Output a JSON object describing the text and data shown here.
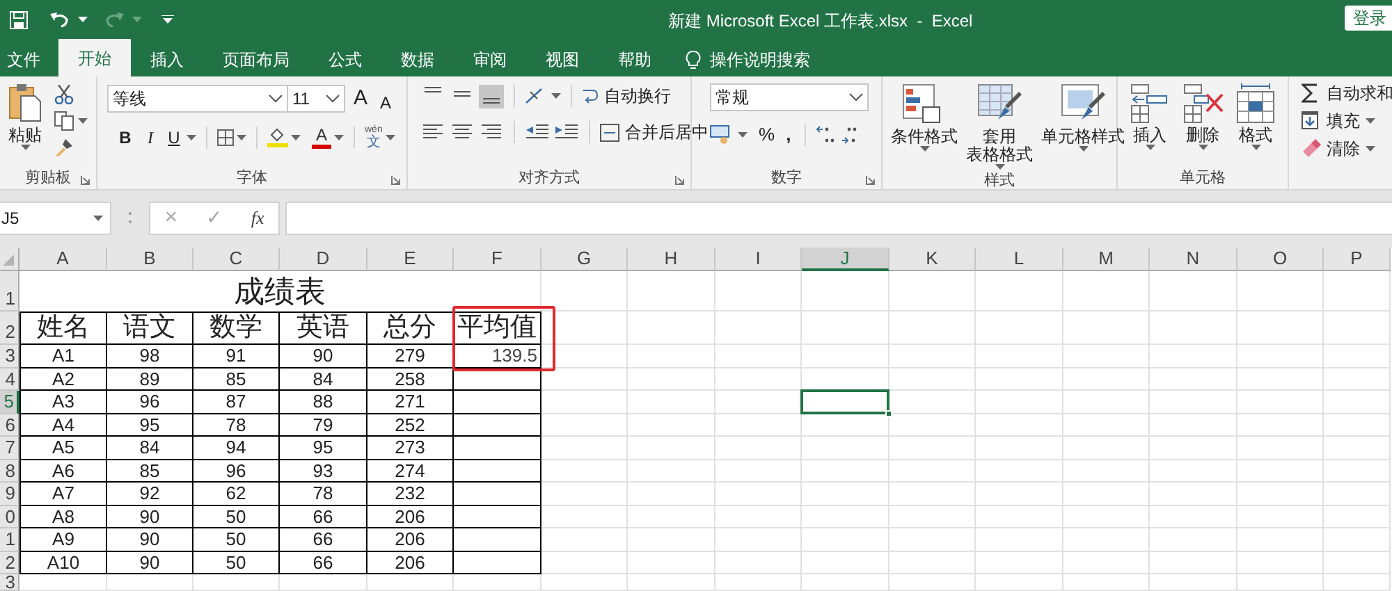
{
  "title_bar": {
    "title": "新建 Microsoft Excel 工作表.xlsx  -  Excel",
    "sign_in": "登录"
  },
  "tabs": [
    {
      "label": "文件",
      "selected": false
    },
    {
      "label": "开始",
      "selected": true
    },
    {
      "label": "插入",
      "selected": false
    },
    {
      "label": "页面布局",
      "selected": false
    },
    {
      "label": "公式",
      "selected": false
    },
    {
      "label": "数据",
      "selected": false
    },
    {
      "label": "审阅",
      "selected": false
    },
    {
      "label": "视图",
      "selected": false
    },
    {
      "label": "帮助",
      "selected": false
    }
  ],
  "tell_me": "操作说明搜索",
  "ribbon": {
    "clipboard": {
      "paste": "粘贴",
      "label": "剪贴板"
    },
    "font": {
      "font_name": "等线",
      "font_size": "11",
      "grow": "A",
      "shrink": "A",
      "bold": "B",
      "italic": "I",
      "underline": "U",
      "font_color": "A",
      "phonetic_top": "wén",
      "phonetic_bottom": "文",
      "label": "字体"
    },
    "alignment": {
      "vertical": [
        {
          "selected": false
        },
        {
          "selected": false
        },
        {
          "selected": true
        }
      ],
      "wrap_text": "自动换行",
      "merge_center": "合并后居中",
      "label": "对齐方式"
    },
    "number": {
      "format": "常规",
      "percent": "%",
      "comma": ",",
      "label": "数字"
    },
    "styles": {
      "buttons": [
        {
          "kind": "conditional",
          "lines": [
            "条件格式"
          ]
        },
        {
          "kind": "table",
          "lines": [
            "套用",
            "表格格式"
          ]
        },
        {
          "kind": "cell",
          "lines": [
            "单元格样式"
          ]
        }
      ],
      "label": "样式"
    },
    "cells": {
      "buttons": [
        {
          "kind": "insert",
          "label": "插入"
        },
        {
          "kind": "delete",
          "label": "删除"
        },
        {
          "kind": "format",
          "label": "格式"
        }
      ],
      "label": "单元格"
    },
    "editing": {
      "items": [
        {
          "kind": "sum",
          "label": "自动求和"
        },
        {
          "kind": "fill",
          "label": "填充"
        },
        {
          "kind": "clear",
          "label": "清除"
        }
      ]
    }
  },
  "formula_bar": {
    "name_box": "J5",
    "cancel": "×",
    "enter": "✓",
    "function": "fx"
  },
  "sheet": {
    "columns": [
      {
        "label": "A",
        "selected": false
      },
      {
        "label": "B",
        "selected": false
      },
      {
        "label": "C",
        "selected": false
      },
      {
        "label": "D",
        "selected": false
      },
      {
        "label": "E",
        "selected": false
      },
      {
        "label": "F",
        "selected": false
      },
      {
        "label": "G",
        "selected": false
      },
      {
        "label": "H",
        "selected": false
      },
      {
        "label": "I",
        "selected": false
      },
      {
        "label": "J",
        "selected": true
      },
      {
        "label": "K",
        "selected": false
      },
      {
        "label": "L",
        "selected": false
      },
      {
        "label": "M",
        "selected": false
      },
      {
        "label": "N",
        "selected": false
      },
      {
        "label": "O",
        "selected": false
      },
      {
        "label": "P",
        "selected": false
      }
    ],
    "rows": [
      {
        "label": "1",
        "selected": false
      },
      {
        "label": "2",
        "selected": false
      },
      {
        "label": "3",
        "selected": false
      },
      {
        "label": "4",
        "selected": false
      },
      {
        "label": "5",
        "selected": true
      },
      {
        "label": "6",
        "selected": false
      },
      {
        "label": "7",
        "selected": false
      },
      {
        "label": "8",
        "selected": false
      },
      {
        "label": "9",
        "selected": false
      },
      {
        "label": "0",
        "selected": false
      },
      {
        "label": "1",
        "selected": false
      },
      {
        "label": "2",
        "selected": false
      },
      {
        "label": "3",
        "selected": false
      }
    ],
    "title": "成绩表",
    "header": [
      "姓名",
      "语文",
      "数学",
      "英语",
      "总分",
      "平均值"
    ],
    "data": [
      [
        "A1",
        "98",
        "91",
        "90",
        "279",
        "139.5"
      ],
      [
        "A2",
        "89",
        "85",
        "84",
        "258"
      ],
      [
        "A3",
        "96",
        "87",
        "88",
        "271"
      ],
      [
        "A4",
        "95",
        "78",
        "79",
        "252"
      ],
      [
        "A5",
        "84",
        "94",
        "95",
        "273"
      ],
      [
        "A6",
        "85",
        "96",
        "93",
        "274"
      ],
      [
        "A7",
        "92",
        "62",
        "78",
        "232"
      ],
      [
        "A8",
        "90",
        "50",
        "66",
        "206"
      ],
      [
        "A9",
        "90",
        "50",
        "66",
        "206"
      ],
      [
        "A10",
        "90",
        "50",
        "66",
        "206"
      ]
    ]
  }
}
